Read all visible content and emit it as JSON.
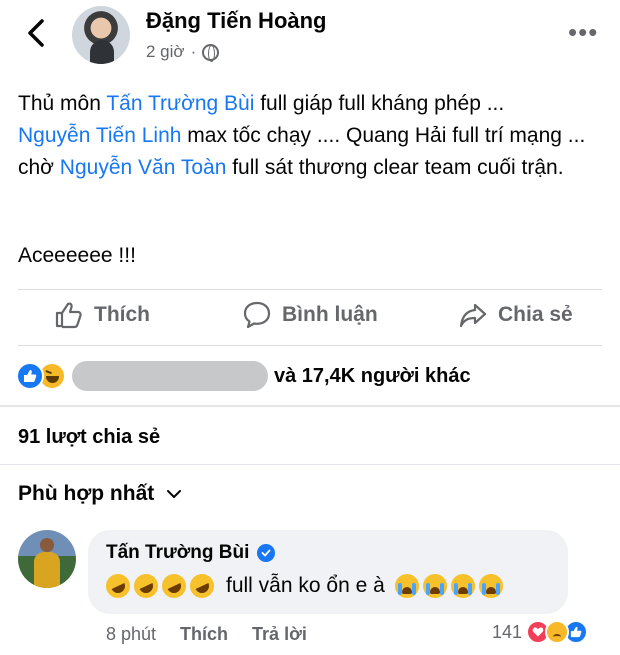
{
  "header": {
    "author_name": "Đặng Tiến Hoàng",
    "time": "2 giờ",
    "separator": "·"
  },
  "post": {
    "line1_pre": "Thủ môn ",
    "tag1": "Tấn Trường Bùi",
    "line1_post": " full giáp full kháng phép ...",
    "tag2": "Nguyễn Tiến Linh",
    "line2_post": " max tốc chạy .... Quang Hải full trí mạng ... chờ ",
    "tag3": "Nguyễn Văn Toàn",
    "line3_post": " full sát thương clear team cuối trận.",
    "extra": "Aceeeeee !!!"
  },
  "actions": {
    "like": "Thích",
    "comment": "Bình luận",
    "share": "Chia sẻ"
  },
  "reactions": {
    "summary": "và 17,4K người khác"
  },
  "shares_count": "91 lượt chia sẻ",
  "sort_label": "Phù hợp nhất",
  "comment": {
    "author": "Tấn Trường Bùi",
    "text": "full vẫn ko ổn e à",
    "time": "8 phút",
    "like": "Thích",
    "reply": "Trả lời",
    "reaction_count": "141"
  },
  "colors": {
    "link": "#1877f2",
    "secondary_text": "#65676b",
    "bubble": "#f0f2f5"
  }
}
